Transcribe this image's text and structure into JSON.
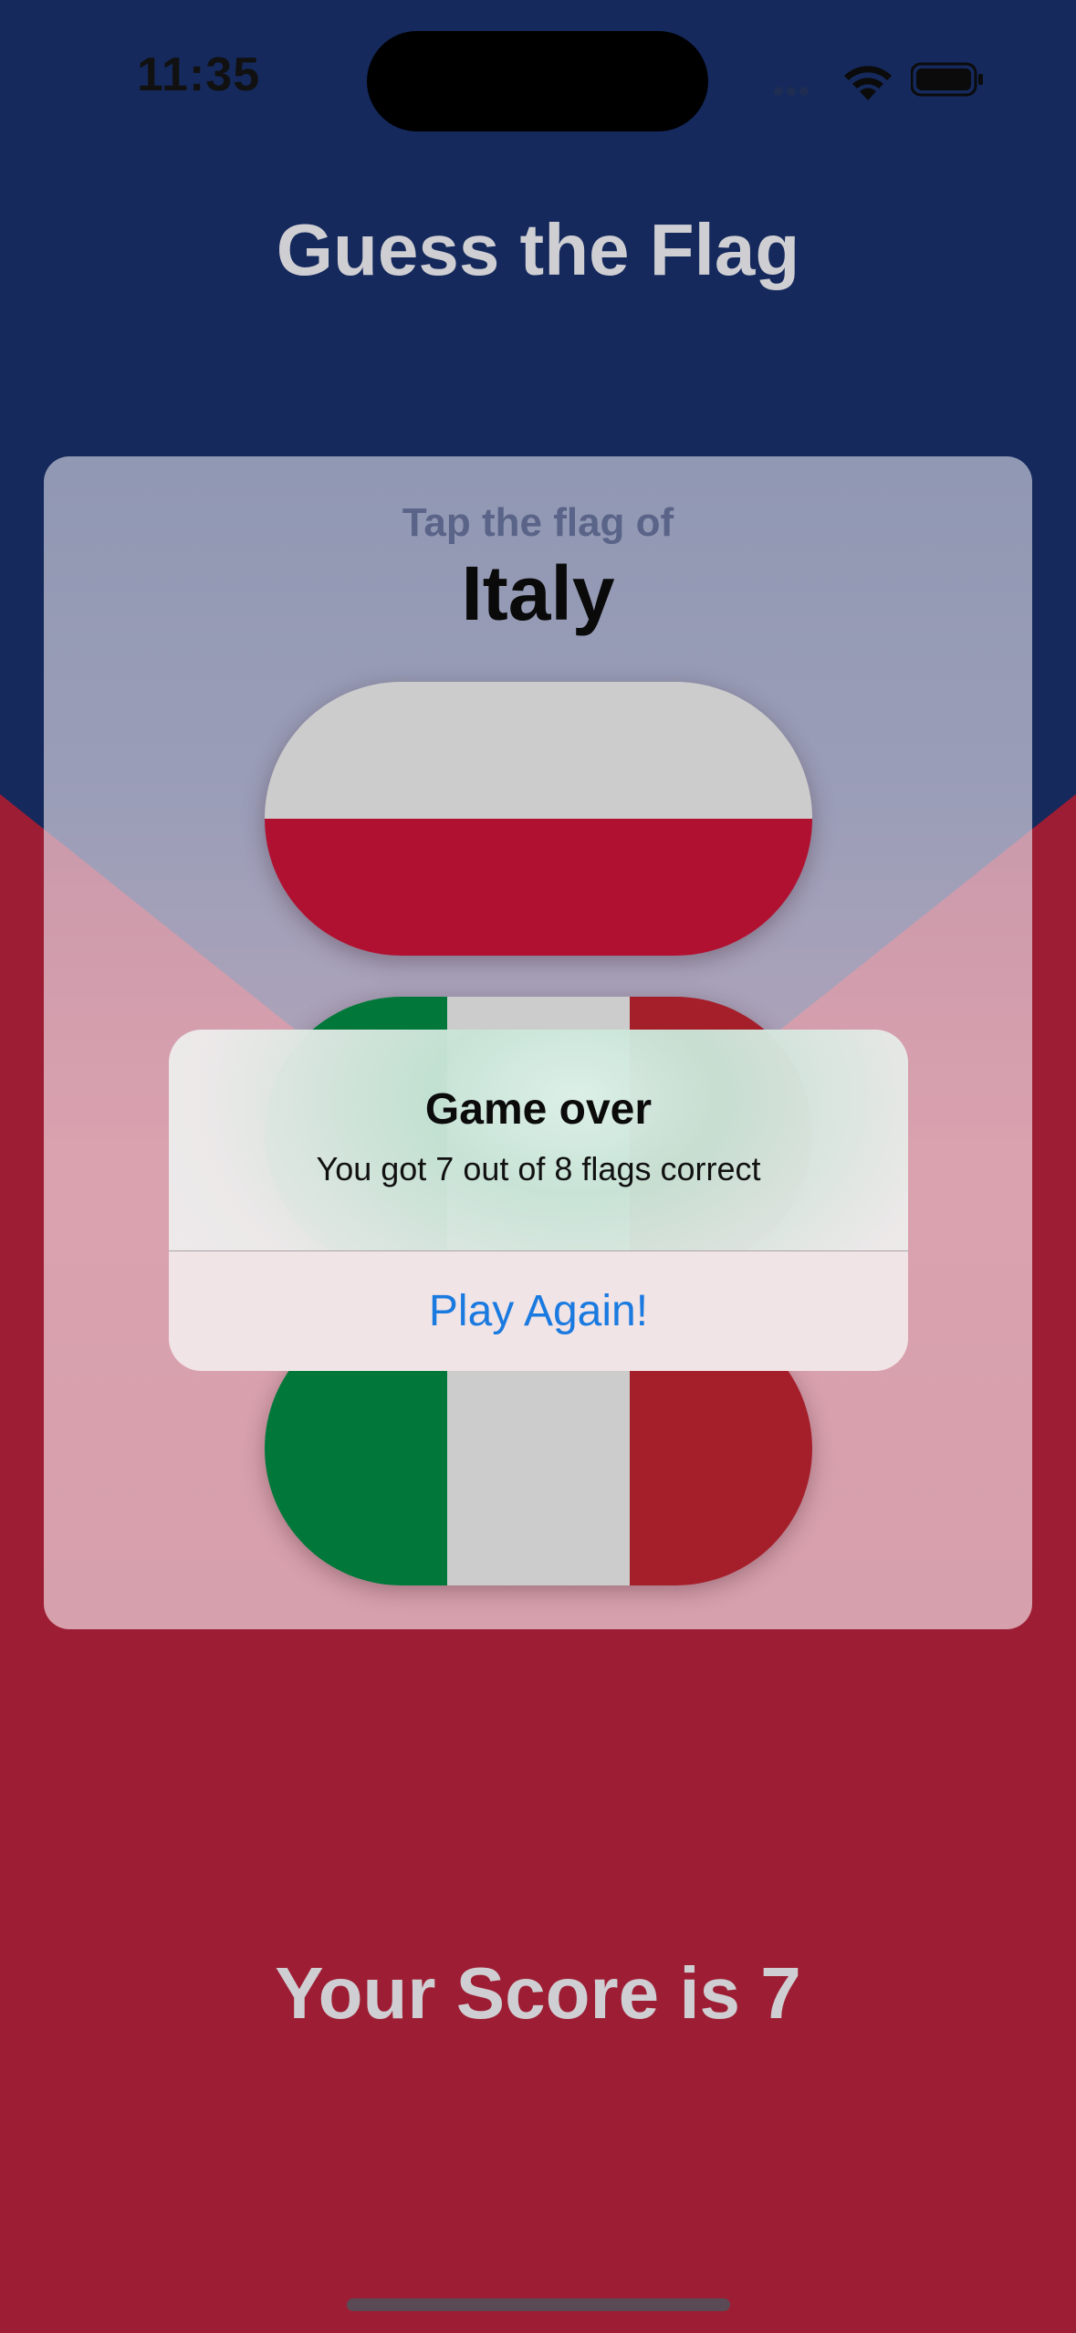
{
  "status_bar": {
    "time": "11:35",
    "wifi_icon": "wifi-icon",
    "battery_icon": "battery-icon"
  },
  "app": {
    "title": "Guess the Flag"
  },
  "prompt": {
    "instruction": "Tap the flag of",
    "country": "Italy"
  },
  "flags": [
    {
      "country_icon": "poland-flag",
      "stripes": "horizontal",
      "colors": [
        "#cccccc",
        "#b11131"
      ]
    },
    {
      "country_icon": "italy-flag",
      "stripes": "vertical",
      "colors": [
        "#01783a",
        "#cccccc",
        "#a51f2b"
      ]
    },
    {
      "country_icon": "italy-flag",
      "stripes": "vertical",
      "colors": [
        "#01783a",
        "#cccccc",
        "#a51f2b"
      ]
    }
  ],
  "alert": {
    "title": "Game over",
    "message": "You got 7 out of 8 flags correct",
    "button_label": "Play Again!",
    "button_color": "#1a7ae0"
  },
  "score": {
    "text": "Your Score is 7"
  },
  "colors": {
    "top_background": "#15295c",
    "bottom_background": "#9d1e34",
    "title_text": "#cfcfd3"
  }
}
